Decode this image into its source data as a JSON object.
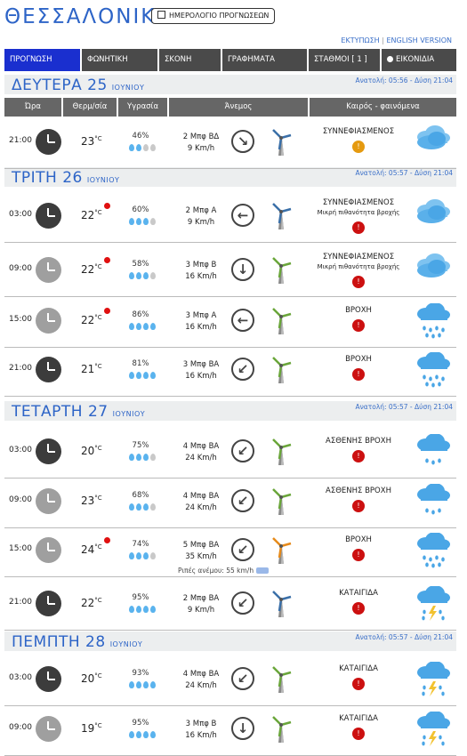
{
  "header": {
    "city": "ΘΕΣΣΑΛΟΝΙΚΗ",
    "calendar_button": "ΗΜΕΡΟΛΟΓΙΟ ΠΡΟΓΝΩΣΕΩΝ",
    "print_link": "ΕΚΤΥΠΩΣΗ",
    "english_link": "ENGLISH VERSION"
  },
  "tabs": [
    {
      "label": "ΠΡΟΓΝΩΣΗ",
      "active": true
    },
    {
      "label": "ΦΩΝΗΤΙΚΗ",
      "active": false
    },
    {
      "label": "ΣΚΟΝΗ",
      "active": false
    },
    {
      "label": "ΓΡΑΦΗΜΑΤΑ",
      "active": false
    },
    {
      "label": "ΣΤΑΘΜΟΙ [ 1 ]",
      "active": false
    },
    {
      "label": "ΕΙΚΟΝΙΔΙΑ",
      "active": false
    }
  ],
  "columns": {
    "time": "Ώρα",
    "temp": "Θερμ/σία",
    "humidity": "Υγρασία",
    "wind": "Άνεμος",
    "weather": "Καιρός - φαινόμενα"
  },
  "days": [
    {
      "name": "ΔΕΥΤΕΡΑ 25",
      "month": "ΙΟΥΝΙΟΥ",
      "sun": "Ανατολή: 05:56 - Δύση 21:04"
    },
    {
      "name": "ΤΡΙΤΗ 26",
      "month": "ΙΟΥΝΙΟΥ",
      "sun": "Ανατολή: 05:57 - Δύση 21:04"
    },
    {
      "name": "ΤΕΤΑΡΤΗ 27",
      "month": "ΙΟΥΝΙΟΥ",
      "sun": "Ανατολή: 05:57 - Δύση 21:04"
    },
    {
      "name": "ΠΕΜΠΤΗ 28",
      "month": "ΙΟΥΝΙΟΥ",
      "sun": "Ανατολή: 05:57 - Δύση 21:04"
    }
  ],
  "rows": [
    {
      "time": "21:00",
      "temp": "23",
      "unit": "°C",
      "hot": false,
      "hum": "46%",
      "drops": 2,
      "wind_bf": "2 Μπφ ΒΔ",
      "wind_kmh": "9 Km/h",
      "arrow": "↘",
      "cond": "ΣΥΝΝΕΦΙΑΣΜΕΝΟΣ",
      "sub": "",
      "warn": "orange",
      "icon": "cloud",
      "clock": "dark",
      "turb": "blue"
    },
    {
      "time": "03:00",
      "temp": "22",
      "unit": "°C",
      "hot": true,
      "hum": "60%",
      "drops": 3,
      "wind_bf": "2 Μπφ Α",
      "wind_kmh": "9 Km/h",
      "arrow": "←",
      "cond": "ΣΥΝΝΕΦΙΑΣΜΕΝΟΣ",
      "sub": "Μικρή πιθανότητα βροχής",
      "warn": "red",
      "icon": "cloud",
      "clock": "dark",
      "turb": "blue"
    },
    {
      "time": "09:00",
      "temp": "22",
      "unit": "°C",
      "hot": true,
      "hum": "58%",
      "drops": 3,
      "wind_bf": "3 Μπφ Β",
      "wind_kmh": "16 Km/h",
      "arrow": "↓",
      "cond": "ΣΥΝΝΕΦΙΑΣΜΕΝΟΣ",
      "sub": "Μικρή πιθανότητα βροχής",
      "warn": "red",
      "icon": "cloud",
      "clock": "light",
      "turb": "green"
    },
    {
      "time": "15:00",
      "temp": "22",
      "unit": "°C",
      "hot": true,
      "hum": "86%",
      "drops": 4,
      "wind_bf": "3 Μπφ Α",
      "wind_kmh": "16 Km/h",
      "arrow": "←",
      "cond": "ΒΡΟΧΗ",
      "sub": "",
      "warn": "red",
      "icon": "rain",
      "clock": "light",
      "turb": "green"
    },
    {
      "time": "21:00",
      "temp": "21",
      "unit": "°C",
      "hot": false,
      "hum": "81%",
      "drops": 4,
      "wind_bf": "3 Μπφ ΒΑ",
      "wind_kmh": "16 Km/h",
      "arrow": "↙",
      "cond": "ΒΡΟΧΗ",
      "sub": "",
      "warn": "red",
      "icon": "rain",
      "clock": "dark",
      "turb": "green"
    },
    {
      "time": "03:00",
      "temp": "20",
      "unit": "°C",
      "hot": false,
      "hum": "75%",
      "drops": 3,
      "wind_bf": "4 Μπφ ΒΑ",
      "wind_kmh": "24 Km/h",
      "arrow": "↙",
      "cond": "ΑΣΘΕΝΗΣ ΒΡΟΧΗ",
      "sub": "",
      "warn": "red",
      "icon": "lightrain",
      "clock": "dark",
      "turb": "green"
    },
    {
      "time": "09:00",
      "temp": "23",
      "unit": "°C",
      "hot": false,
      "hum": "68%",
      "drops": 3,
      "wind_bf": "4 Μπφ ΒΑ",
      "wind_kmh": "24 Km/h",
      "arrow": "↙",
      "cond": "ΑΣΘΕΝΗΣ ΒΡΟΧΗ",
      "sub": "",
      "warn": "red",
      "icon": "lightrain",
      "clock": "light",
      "turb": "green"
    },
    {
      "time": "15:00",
      "temp": "24",
      "unit": "°C",
      "hot": true,
      "hum": "74%",
      "drops": 3,
      "wind_bf": "5 Μπφ ΒΑ",
      "wind_kmh": "35 Km/h",
      "arrow": "↙",
      "cond": "ΒΡΟΧΗ",
      "sub": "",
      "warn": "red",
      "icon": "rain",
      "clock": "light",
      "turb": "orange",
      "gust": "Ριπές ανέμου: 55 km/h"
    },
    {
      "time": "21:00",
      "temp": "22",
      "unit": "°C",
      "hot": false,
      "hum": "95%",
      "drops": 4,
      "wind_bf": "2 Μπφ ΒΑ",
      "wind_kmh": "9 Km/h",
      "arrow": "↙",
      "cond": "ΚΑΤΑΙΓΙΔΑ",
      "sub": "",
      "warn": "red",
      "icon": "storm",
      "clock": "dark",
      "turb": "blue"
    },
    {
      "time": "03:00",
      "temp": "20",
      "unit": "°C",
      "hot": false,
      "hum": "93%",
      "drops": 4,
      "wind_bf": "4 Μπφ ΒΑ",
      "wind_kmh": "24 Km/h",
      "arrow": "↙",
      "cond": "ΚΑΤΑΙΓΙΔΑ",
      "sub": "",
      "warn": "red",
      "icon": "storm",
      "clock": "dark",
      "turb": "green"
    },
    {
      "time": "09:00",
      "temp": "19",
      "unit": "°C",
      "hot": false,
      "hum": "95%",
      "drops": 4,
      "wind_bf": "3 Μπφ Β",
      "wind_kmh": "16 Km/h",
      "arrow": "↓",
      "cond": "ΚΑΤΑΙΓΙΔΑ",
      "sub": "",
      "warn": "red",
      "icon": "storm",
      "clock": "light",
      "turb": "green"
    }
  ]
}
